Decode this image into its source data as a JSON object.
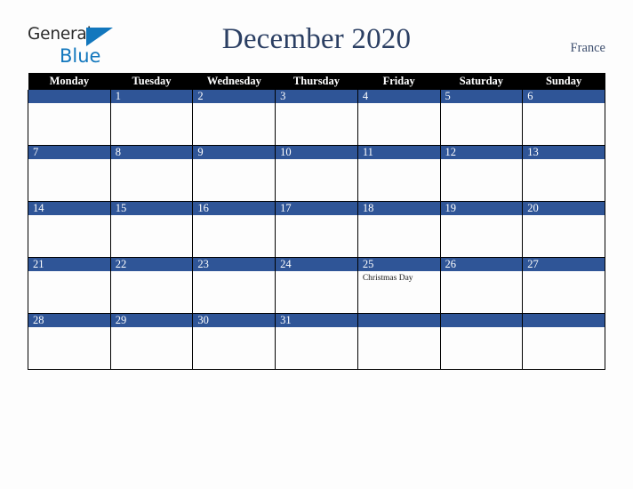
{
  "brand": {
    "name_part1": "General",
    "name_part2": "Blue",
    "triangle_icon": "triangle-icon",
    "colors": {
      "text_dark": "#2b2b2b",
      "blue": "#1277bd"
    }
  },
  "header": {
    "title": "December 2020",
    "country": "France",
    "title_color": "#2b3f63"
  },
  "calendar": {
    "month": "December",
    "year": "2020",
    "accent_color": "#2f5597",
    "header_bg": "#000000",
    "weekdays": [
      "Monday",
      "Tuesday",
      "Wednesday",
      "Thursday",
      "Friday",
      "Saturday",
      "Sunday"
    ],
    "weeks": [
      [
        {
          "day": "",
          "events": []
        },
        {
          "day": "1",
          "events": []
        },
        {
          "day": "2",
          "events": []
        },
        {
          "day": "3",
          "events": []
        },
        {
          "day": "4",
          "events": []
        },
        {
          "day": "5",
          "events": []
        },
        {
          "day": "6",
          "events": []
        }
      ],
      [
        {
          "day": "7",
          "events": []
        },
        {
          "day": "8",
          "events": []
        },
        {
          "day": "9",
          "events": []
        },
        {
          "day": "10",
          "events": []
        },
        {
          "day": "11",
          "events": []
        },
        {
          "day": "12",
          "events": []
        },
        {
          "day": "13",
          "events": []
        }
      ],
      [
        {
          "day": "14",
          "events": []
        },
        {
          "day": "15",
          "events": []
        },
        {
          "day": "16",
          "events": []
        },
        {
          "day": "17",
          "events": []
        },
        {
          "day": "18",
          "events": []
        },
        {
          "day": "19",
          "events": []
        },
        {
          "day": "20",
          "events": []
        }
      ],
      [
        {
          "day": "21",
          "events": []
        },
        {
          "day": "22",
          "events": []
        },
        {
          "day": "23",
          "events": []
        },
        {
          "day": "24",
          "events": []
        },
        {
          "day": "25",
          "events": [
            "Christmas Day"
          ]
        },
        {
          "day": "26",
          "events": []
        },
        {
          "day": "27",
          "events": []
        }
      ],
      [
        {
          "day": "28",
          "events": []
        },
        {
          "day": "29",
          "events": []
        },
        {
          "day": "30",
          "events": []
        },
        {
          "day": "31",
          "events": []
        },
        {
          "day": "",
          "events": []
        },
        {
          "day": "",
          "events": []
        },
        {
          "day": "",
          "events": []
        }
      ]
    ]
  }
}
